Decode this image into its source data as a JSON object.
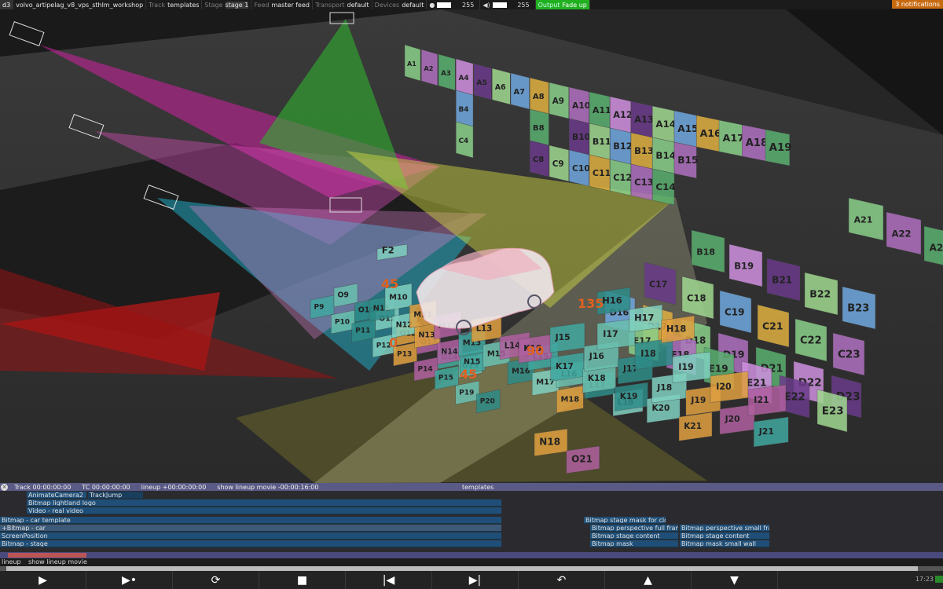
{
  "topbar": {
    "app": "d3",
    "project": "volvo_artipelag_v8_vps_sthlm_workshop",
    "track_label": "Track",
    "track_value": "templates",
    "stage_label": "Stage",
    "stage_value": "stage 1",
    "feed_label": "Feed",
    "feed_value": "master feed",
    "transport_label": "Transport",
    "transport_value": "default",
    "devices_label": "Devices",
    "devices_value": "default",
    "brightness_value": "255",
    "volume_value": "255",
    "output_label": "Output",
    "output_value": "Fade up",
    "notifications": "3 notifications"
  },
  "viewport": {
    "left_wall_columns": [
      "A1",
      "A2",
      "A3",
      "A4",
      "A5",
      "A6",
      "A7",
      "A8",
      "A9",
      "A10",
      "A11",
      "A12",
      "A13",
      "A14",
      "A15",
      "A16",
      "A17",
      "A18",
      "A19"
    ],
    "left_wall_row_b": [
      "B4",
      "B8",
      "B10",
      "B11",
      "B12",
      "B13",
      "B14",
      "B15"
    ],
    "left_wall_row_c": [
      "C4",
      "C8",
      "C9",
      "C10",
      "C11",
      "C12",
      "C13",
      "C14"
    ],
    "right_wall_a": [
      "A21",
      "A22",
      "A23"
    ],
    "right_wall_b": [
      "B18",
      "B19",
      "B21",
      "B22",
      "B23"
    ],
    "right_wall_c": [
      "C17",
      "C18",
      "C19",
      "C21",
      "C22",
      "C23"
    ],
    "right_wall_d": [
      "D16",
      "D17",
      "D18",
      "D19",
      "D21",
      "D22",
      "D23"
    ],
    "right_wall_e": [
      "E17",
      "E18",
      "E19",
      "E21",
      "E22",
      "E23"
    ],
    "floor_p": [
      "P9",
      "P10",
      "P11",
      "P12",
      "P13",
      "P14",
      "P15",
      "P19",
      "P20"
    ],
    "floor_o": [
      "O9",
      "O10",
      "O11",
      "O12",
      "O13",
      "O14",
      "O15"
    ],
    "floor_n": [
      "N11",
      "N12",
      "N13",
      "N14",
      "N15"
    ],
    "floor_m": [
      "M10",
      "M11",
      "M12",
      "M13",
      "M15",
      "M16",
      "M17",
      "M18"
    ],
    "floor_l": [
      "L13",
      "L14",
      "L15",
      "L16",
      "L17",
      "L18"
    ],
    "floor_k": [
      "K16",
      "K17",
      "K18",
      "K19",
      "K20",
      "K21"
    ],
    "floor_j": [
      "J15",
      "J16",
      "J17",
      "J18",
      "J19",
      "J20",
      "J21"
    ],
    "floor_i": [
      "I17",
      "I18",
      "I19",
      "I20",
      "I21"
    ],
    "floor_h": [
      "H16",
      "H17",
      "H18"
    ],
    "floor_f": [
      "F2"
    ],
    "floor_misc": [
      "N18",
      "O21"
    ],
    "orange_numbers": [
      "45",
      "0",
      "45",
      "90",
      "135"
    ]
  },
  "timeline": {
    "header_track": "Track 00:00:00:00",
    "header_tc": "TC 00:00:00:00",
    "header_lineup": "lineup +00:00:00:00",
    "header_show": "show lineup movie -00:00:16:00",
    "header_center": "templates",
    "layers": {
      "animate_camera": "AnimateCamera2",
      "track_jump": "TrackJump",
      "bitmap_logo": "Bitmap lightland logo",
      "video_real": "Video - real video",
      "bitmap_car_template": "Bitmap - car template",
      "bitmap_car": "+Bitmap - car",
      "screen_position": "ScreenPosition",
      "bitmap_stage": "Bitmap - stage",
      "stage_mask_cloth": "Bitmap stage mask for cloth",
      "persp_full": "Bitmap perspective full frame",
      "persp_small": "Bitmap perspective small frame",
      "stage_content_l": "Bitmap stage content",
      "stage_content_r": "Bitmap stage content",
      "mask": "Bitmap mask",
      "mask_small_wall": "Bitmap mask small wall"
    },
    "lineup_label": "lineup",
    "lineup_value": "show lineup movie"
  },
  "transport": {
    "buttons": [
      "play",
      "play-to-end",
      "loop-section",
      "stop",
      "return-to-start",
      "skip-to-end",
      "back",
      "up",
      "down"
    ],
    "glyphs": [
      "▶",
      "▶•",
      "⟳",
      "■",
      "|◀",
      "▶|",
      "↶",
      "▲",
      "▼"
    ],
    "clock": "17:23"
  },
  "colors": {
    "magenta_beam": "#d020a0",
    "green_beam": "#30b030",
    "cyan_beam": "#20a8c0",
    "red_beam": "#c01818",
    "yellow_beam": "#d8e040",
    "output_green": "#20b020",
    "notification_orange": "#c76a10",
    "timeline_header": "#5a5a86",
    "layer_blue": "#1f4f78"
  }
}
